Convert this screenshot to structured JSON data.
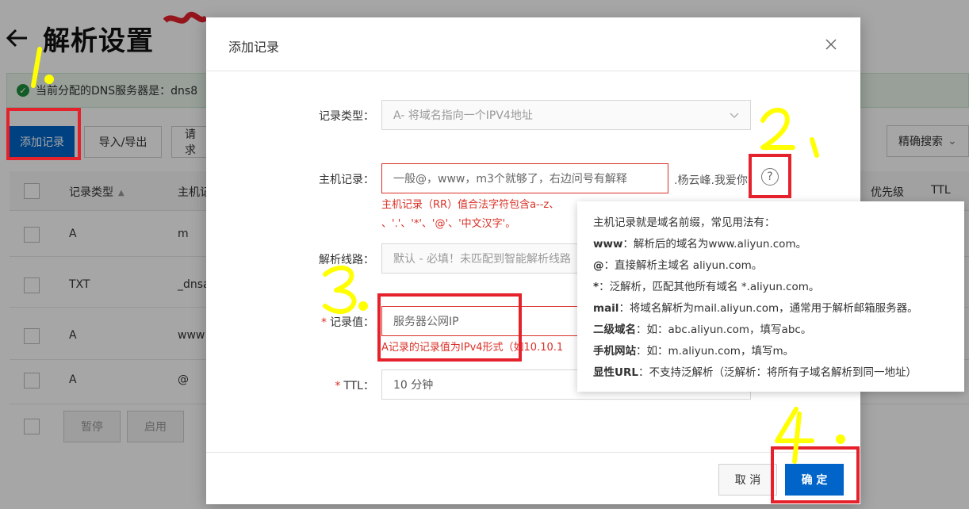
{
  "page": {
    "title": "解析设置",
    "info_text": "当前分配的DNS服务器是：dns8",
    "toolbar": {
      "add_record": "添加记录",
      "import_export": "导入/导出",
      "request_partial": "请求",
      "exact_search": "精确搜索"
    },
    "table": {
      "headers": {
        "record_type": "记录类型",
        "host": "主机记",
        "priority": "优先级",
        "ttl": "TTL"
      },
      "rows": [
        {
          "type": "A",
          "host": "m"
        },
        {
          "type": "TXT",
          "host": "_dnsa"
        },
        {
          "type": "A",
          "host": "www"
        },
        {
          "type": "A",
          "host": "@"
        }
      ]
    },
    "footer": {
      "pause": "暂停",
      "enable": "启用"
    }
  },
  "dialog": {
    "title": "添加记录",
    "record_type": {
      "label": "记录类型：",
      "value": "A- 将域名指向一个IPV4地址"
    },
    "host": {
      "label": "主机记录：",
      "placeholder": "一般@，www，m3个就够了，右边问号有解释",
      "suffix": ".杨云峰.我爱你",
      "error_line1": "主机记录（RR）值合法字符包含a--z、",
      "error_line2": "、'.'、'*'、'@'、'中文汉字'。"
    },
    "line": {
      "label": "解析线路：",
      "value": "默认 - 必填！未匹配到智能解析线路"
    },
    "value": {
      "label": "记录值：",
      "required_mark": "*",
      "placeholder": "服务器公网IP",
      "error": "A记录的记录值为IPv4形式（如10.10.1"
    },
    "ttl": {
      "label": "TTL：",
      "required_mark": "*",
      "value": "10 分钟"
    },
    "cancel": "取 消",
    "confirm": "确 定"
  },
  "tooltip": {
    "intro": "主机记录就是域名前缀，常见用法有：",
    "items": [
      {
        "key": "www",
        "text": "：解析后的域名为www.aliyun.com。"
      },
      {
        "key": "@",
        "text": "：直接解析主域名 aliyun.com。"
      },
      {
        "key": "*",
        "text": "：泛解析，匹配其他所有域名 *.aliyun.com。"
      },
      {
        "key": "mail",
        "text": "：将域名解析为mail.aliyun.com，通常用于解析邮箱服务器。"
      },
      {
        "key": "二级域名",
        "text": "：如：abc.aliyun.com，填写abc。"
      },
      {
        "key": "手机网站",
        "text": "：如：m.aliyun.com，填写m。"
      },
      {
        "key": "显性URL",
        "text": "：不支持泛解析（泛解析：将所有子域名解析到同一地址）"
      }
    ]
  },
  "colors": {
    "primary": "#0064c8",
    "error": "#d93026",
    "annotation_box": "#e5212b",
    "annotation_pen": "#ffff00"
  }
}
